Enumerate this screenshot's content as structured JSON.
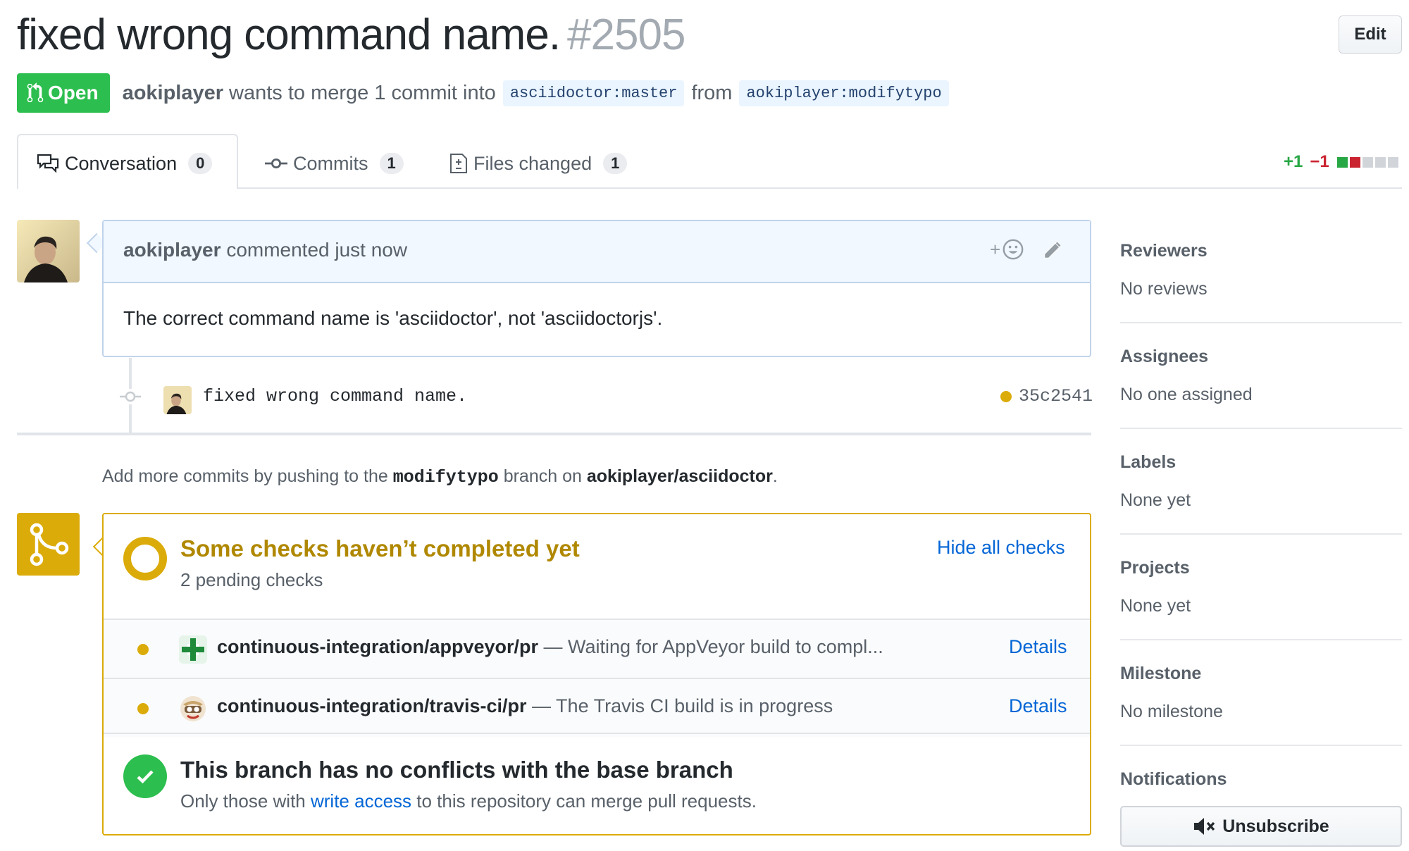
{
  "header": {
    "title": "fixed wrong command name.",
    "number": "#2505",
    "edit_label": "Edit",
    "state_label": "Open",
    "author": "aokiplayer",
    "merge_text": "wants to merge 1 commit into",
    "base_branch": "asciidoctor:master",
    "from_text": "from",
    "head_branch": "aokiplayer:modifytypo"
  },
  "tabs": [
    {
      "label": "Conversation",
      "count": "0",
      "icon": "comment-discussion-icon"
    },
    {
      "label": "Commits",
      "count": "1",
      "icon": "git-commit-icon"
    },
    {
      "label": "Files changed",
      "count": "1",
      "icon": "file-diff-icon"
    }
  ],
  "diffstat": {
    "additions": "+1",
    "deletions": "−1",
    "colors": {
      "add": "#28a745",
      "del": "#cb2431",
      "neutral": "#d1d5da"
    }
  },
  "comment": {
    "author": "aokiplayer",
    "action": "commented just now",
    "reaction_label": "+",
    "body": "The correct command name is 'asciidoctor', not 'asciidoctorjs'."
  },
  "commit": {
    "message": "fixed wrong command name.",
    "sha": "35c2541"
  },
  "push_hint": {
    "prefix": "Add more commits by pushing to the",
    "branch": "modifytypo",
    "middle": "branch on",
    "repo": "aokiplayer/asciidoctor",
    "suffix": "."
  },
  "checks": {
    "title": "Some checks haven’t completed yet",
    "subtitle": "2 pending checks",
    "hide_label": "Hide all checks",
    "items": [
      {
        "name": "continuous-integration/appveyor/pr",
        "desc": "— Waiting for AppVeyor build to compl...",
        "details": "Details",
        "icon": "appveyor-icon"
      },
      {
        "name": "continuous-integration/travis-ci/pr",
        "desc": "— The Travis CI build is in progress",
        "details": "Details",
        "icon": "travis-ci-icon"
      }
    ]
  },
  "merge_status": {
    "title": "This branch has no conflicts with the base branch",
    "sub_prefix": "Only those with",
    "sub_link": "write access",
    "sub_suffix": "to this repository can merge pull requests."
  },
  "sidebar": {
    "reviewers": {
      "label": "Reviewers",
      "value": "No reviews"
    },
    "assignees": {
      "label": "Assignees",
      "value": "No one assigned"
    },
    "labels": {
      "label": "Labels",
      "value": "None yet"
    },
    "projects": {
      "label": "Projects",
      "value": "None yet"
    },
    "milestone": {
      "label": "Milestone",
      "value": "No milestone"
    },
    "notifications": {
      "label": "Notifications",
      "button": "Unsubscribe"
    }
  },
  "colors": {
    "open": "#2cbe4e",
    "pending": "#dbab09",
    "link": "#0366d6"
  }
}
